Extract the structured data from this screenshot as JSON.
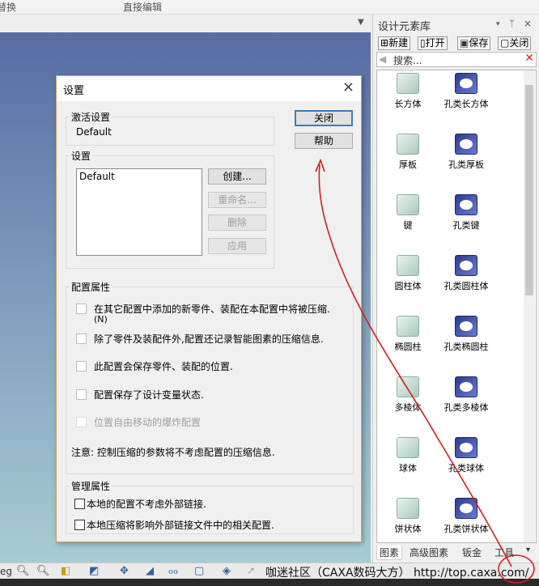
{
  "ribbon": {
    "tab_left": "替换",
    "tab_direct_edit": "直接编辑"
  },
  "panel": {
    "title": "设计元素库",
    "pin": "ᛘ",
    "close": "×",
    "menu": "▾",
    "toolbar": {
      "new": "新建",
      "open": "打开",
      "save": "保存",
      "close": "关闭"
    },
    "search": {
      "placeholder": "搜索..."
    },
    "items": [
      {
        "label": "长方体",
        "kind": "solid"
      },
      {
        "label": "孔类长方体",
        "kind": "hole"
      },
      {
        "label": "厚板",
        "kind": "solid"
      },
      {
        "label": "孔类厚板",
        "kind": "hole"
      },
      {
        "label": "键",
        "kind": "solid"
      },
      {
        "label": "孔类键",
        "kind": "hole"
      },
      {
        "label": "圆柱体",
        "kind": "solid"
      },
      {
        "label": "孔类圆柱体",
        "kind": "hole"
      },
      {
        "label": "椭圆柱",
        "kind": "solid"
      },
      {
        "label": "孔类椭圆柱",
        "kind": "hole"
      },
      {
        "label": "多棱体",
        "kind": "solid"
      },
      {
        "label": "孔类多棱体",
        "kind": "hole"
      },
      {
        "label": "球体",
        "kind": "solid"
      },
      {
        "label": "孔类球体",
        "kind": "hole"
      },
      {
        "label": "饼状体",
        "kind": "solid"
      },
      {
        "label": "孔类饼状体",
        "kind": "hole"
      }
    ],
    "tabs": [
      "图素",
      "高级图素",
      "钣金",
      "工具"
    ]
  },
  "dialog": {
    "title": "设置",
    "active_group": "激活设置",
    "active_value": "Default",
    "settings_group": "设置",
    "settings_list": [
      "Default"
    ],
    "buttons": {
      "close": "关闭",
      "help": "帮助",
      "create": "创建...",
      "rename": "重命名...",
      "delete": "删除",
      "apply": "应用"
    },
    "config_group": "配置属性",
    "config_options": [
      {
        "label": "在其它配置中添加的新零件、装配在本配置中将被压缩.",
        "sub": "(N)",
        "checked": false,
        "enabled": true
      },
      {
        "label": "除了零件及装配件外,配置还记录智能图素的压缩信息.",
        "checked": false,
        "enabled": true
      },
      {
        "label": "此配置会保存零件、装配的位置.",
        "checked": false,
        "enabled": true
      },
      {
        "label": "配置保存了设计变量状态.",
        "checked": false,
        "enabled": true
      },
      {
        "label": "位置自由移动的爆炸配置",
        "checked": false,
        "enabled": false
      }
    ],
    "note": "注意: 控制压缩的参数将不考虑配置的压缩信息.",
    "manage_group": "管理属性",
    "manage_options": [
      {
        "label": "本地的配置不考虑外部链接.",
        "checked": false
      },
      {
        "label": "本地压缩将影响外部链接文件中的相关配置.",
        "checked": false
      }
    ]
  },
  "statusbar": {
    "watermark": "咖迷社区（CAXA数码大方） http://top.caxa.com/",
    "left_text": "eg"
  },
  "annotation_color": "#d42020"
}
